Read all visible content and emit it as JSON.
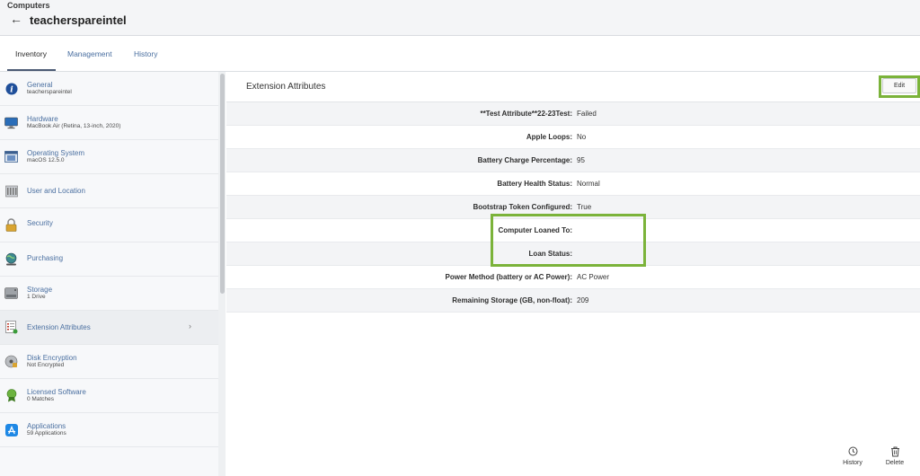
{
  "header": {
    "breadcrumb": "Computers",
    "title": "teacherspareintel"
  },
  "tabs": [
    {
      "label": "Inventory",
      "active": true
    },
    {
      "label": "Management",
      "active": false
    },
    {
      "label": "History",
      "active": false
    }
  ],
  "sidebar": {
    "items": [
      {
        "title": "General",
        "subtitle": "teacherspareintel",
        "icon": "info-icon"
      },
      {
        "title": "Hardware",
        "subtitle": "MacBook Air (Retina, 13-inch, 2020)",
        "icon": "monitor-icon"
      },
      {
        "title": "Operating System",
        "subtitle": "macOS 12.5.0",
        "icon": "os-window-icon"
      },
      {
        "title": "User and Location",
        "subtitle": "",
        "icon": "building-icon"
      },
      {
        "title": "Security",
        "subtitle": "",
        "icon": "lock-icon"
      },
      {
        "title": "Purchasing",
        "subtitle": "",
        "icon": "globe-icon"
      },
      {
        "title": "Storage",
        "subtitle": "1 Drive",
        "icon": "drive-icon"
      },
      {
        "title": "Extension Attributes",
        "subtitle": "",
        "icon": "checklist-icon",
        "active": true,
        "chevron": "›"
      },
      {
        "title": "Disk Encryption",
        "subtitle": "Not Encrypted",
        "icon": "disk-lock-icon"
      },
      {
        "title": "Licensed Software",
        "subtitle": "0 Matches",
        "icon": "ribbon-icon"
      },
      {
        "title": "Applications",
        "subtitle": "59 Applications",
        "icon": "app-store-icon"
      }
    ]
  },
  "main": {
    "section_title": "Extension Attributes",
    "edit_label": "Edit",
    "rows": [
      {
        "label": "**Test Attribute**22-23Test:",
        "value": "Failed"
      },
      {
        "label": "Apple Loops:",
        "value": "No"
      },
      {
        "label": "Battery Charge Percentage:",
        "value": "95"
      },
      {
        "label": "Battery Health Status:",
        "value": "Normal"
      },
      {
        "label": "Bootstrap Token Configured:",
        "value": "True"
      },
      {
        "label": "Computer Loaned To:",
        "value": ""
      },
      {
        "label": "Loan Status:",
        "value": ""
      },
      {
        "label": "Power Method (battery or AC Power):",
        "value": "AC Power"
      },
      {
        "label": "Remaining Storage (GB, non-float):",
        "value": "209"
      }
    ]
  },
  "footer": {
    "history_label": "History",
    "delete_label": "Delete"
  },
  "colors": {
    "highlight": "#7bb33a",
    "link": "#4a6fa0"
  }
}
